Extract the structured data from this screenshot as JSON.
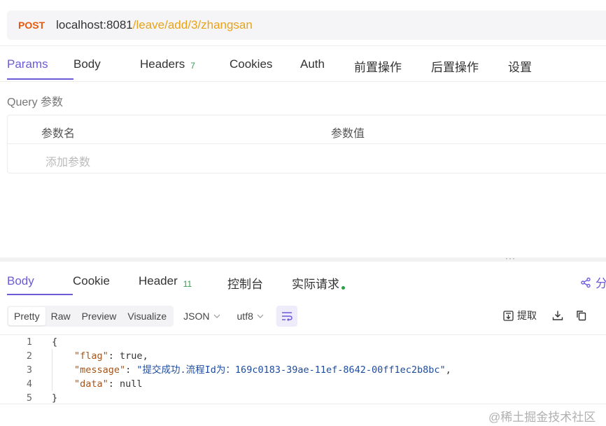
{
  "request": {
    "method": "POST",
    "url_host": "localhost:8081",
    "url_path": "/leave/add/3/zhangsan"
  },
  "request_tabs": [
    {
      "label": "Params",
      "active": true
    },
    {
      "label": "Body"
    },
    {
      "label": "Headers",
      "badge": "7"
    },
    {
      "label": "Cookies"
    },
    {
      "label": "Auth"
    },
    {
      "label": "前置操作"
    },
    {
      "label": "后置操作"
    },
    {
      "label": "设置"
    }
  ],
  "params": {
    "title": "Query 参数",
    "col_name": "参数名",
    "col_value": "参数值",
    "add_placeholder": "添加参数"
  },
  "response_tabs": [
    {
      "label": "Body",
      "active": true
    },
    {
      "label": "Cookie"
    },
    {
      "label": "Header",
      "badge": "11"
    },
    {
      "label": "控制台"
    },
    {
      "label": "实际请求"
    }
  ],
  "share_label": "分",
  "toolbar": {
    "views": [
      "Pretty",
      "Raw",
      "Preview",
      "Visualize"
    ],
    "format": "JSON",
    "encoding": "utf8",
    "extract_label": "提取"
  },
  "code_lines": [
    {
      "n": "1",
      "open": "{"
    },
    {
      "n": "2",
      "key": "\"flag\"",
      "sep": ": ",
      "value": "true",
      "end": ","
    },
    {
      "n": "3",
      "key": "\"message\"",
      "sep": ": ",
      "str": "\"提交成功.流程Id为：169c0183-39ae-11ef-8642-00ff1ec2b8bc\"",
      "end": ","
    },
    {
      "n": "4",
      "key": "\"data\"",
      "sep": ": ",
      "value": "null",
      "end": ""
    },
    {
      "n": "5",
      "close": "}"
    }
  ],
  "watermark": "@稀土掘金技术社区",
  "colors": {
    "accent": "#6b5bd6",
    "method": "#e8590c",
    "path": "#e8a317",
    "badge": "#2e9e4a"
  }
}
